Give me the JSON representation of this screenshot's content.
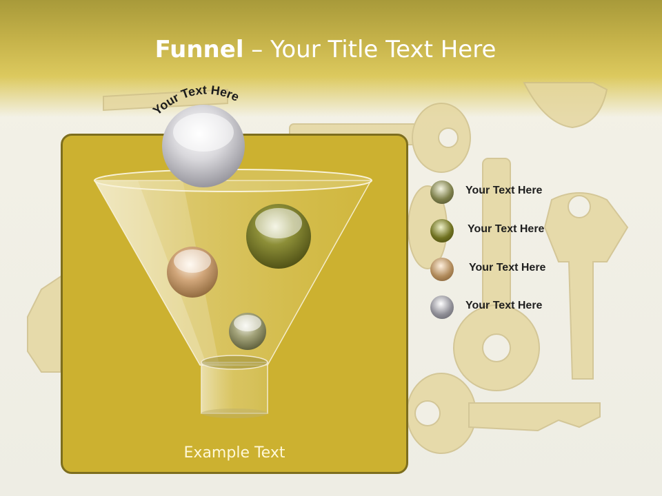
{
  "slide": {
    "title_bold": "Funnel",
    "title_rest": " – Your Title Text Here",
    "arc_text": "Your Text Here",
    "example_text": "Example Text"
  },
  "legend": [
    {
      "label": "Your  Text Here",
      "color": "#7d7f4a"
    },
    {
      "label": "Your  Text Here",
      "color": "#6f7120"
    },
    {
      "label": "Your  Text Here",
      "color": "#b08a5a"
    },
    {
      "label": "Your  Text Here",
      "color": "#8f8e96"
    }
  ],
  "colors": {
    "band": "#c6b34a",
    "panel": "#ccb130",
    "panel_border": "#7d6e1e",
    "background": "#f2f0e6"
  }
}
